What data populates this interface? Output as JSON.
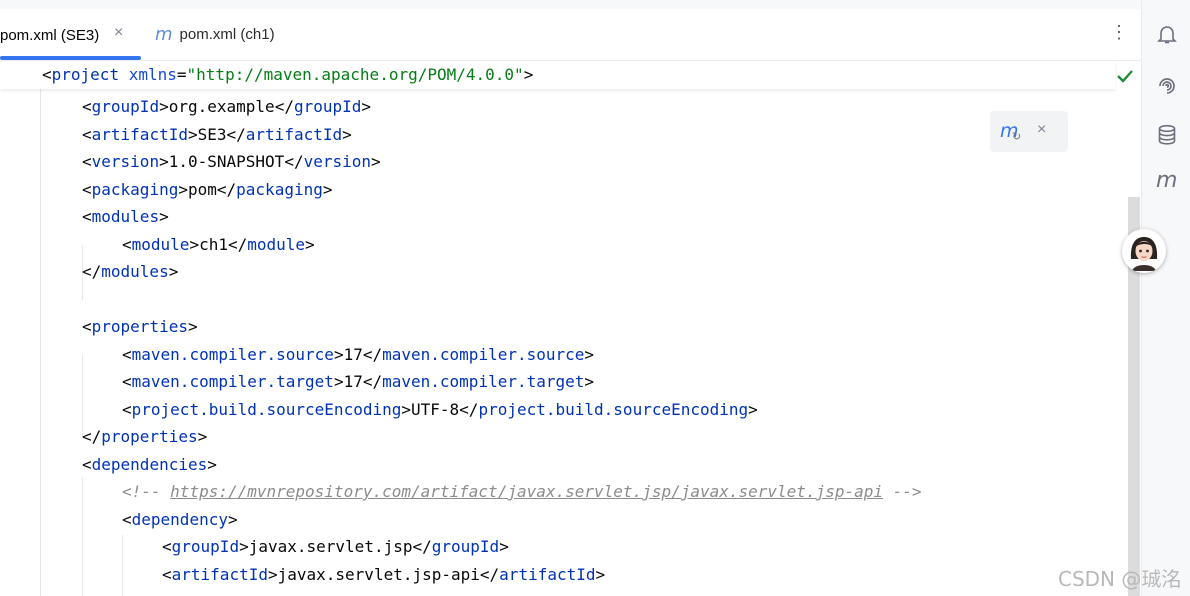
{
  "tabs": [
    {
      "label": "pom.xml (SE3)",
      "active": true,
      "closable": true
    },
    {
      "label": "pom.xml (ch1)",
      "active": false,
      "icon": "maven-m-icon"
    }
  ],
  "tab_close_glyph": "×",
  "tab_more_glyph": "⋮",
  "sticky_header": {
    "open": "<",
    "tag": "project",
    "attr": "xmlns",
    "eq": "=",
    "value": "\"http://maven.apache.org/POM/4.0.0\"",
    "close": ">"
  },
  "code_lines": [
    {
      "indent": 1,
      "tag": "groupId",
      "text": "org.example"
    },
    {
      "indent": 1,
      "tag": "artifactId",
      "text": "SE3"
    },
    {
      "indent": 1,
      "tag": "version",
      "text": "1.0-SNAPSHOT"
    },
    {
      "indent": 1,
      "tag": "packaging",
      "text": "pom"
    },
    {
      "indent": 1,
      "open_only": "modules"
    },
    {
      "indent": 2,
      "tag": "module",
      "text": "ch1"
    },
    {
      "indent": 1,
      "close_only": "modules"
    },
    {
      "indent": 0,
      "blank": true
    },
    {
      "indent": 1,
      "open_only": "properties"
    },
    {
      "indent": 2,
      "tag": "maven.compiler.source",
      "text": "17"
    },
    {
      "indent": 2,
      "tag": "maven.compiler.target",
      "text": "17"
    },
    {
      "indent": 2,
      "tag": "project.build.sourceEncoding",
      "text": "UTF-8"
    },
    {
      "indent": 1,
      "close_only": "properties"
    },
    {
      "indent": 1,
      "open_only": "dependencies"
    },
    {
      "indent": 2,
      "comment_open": "<!-- ",
      "comment_link": "https://mvnrepository.com/artifact/javax.servlet.jsp/javax.servlet.jsp-api",
      "comment_close": " -->"
    },
    {
      "indent": 2,
      "open_only": "dependency"
    },
    {
      "indent": 3,
      "tag": "groupId",
      "text": "javax.servlet.jsp"
    },
    {
      "indent": 3,
      "tag": "artifactId",
      "text": "javax.servlet.jsp-api"
    }
  ],
  "status": {
    "inspection": "no-problems-checkmark-icon"
  },
  "maven_popup": {
    "icon": "maven-reload-icon",
    "close_glyph": "×"
  },
  "right_tools": [
    "notifications-bell-icon",
    "ai-assistant-icon",
    "database-icon",
    "maven-m-icon"
  ],
  "watermark": "CSDN @珹洺",
  "colors": {
    "tag": "#0033b3",
    "string": "#067d17",
    "comment": "#8c8c8c",
    "accent": "#3574f0"
  }
}
